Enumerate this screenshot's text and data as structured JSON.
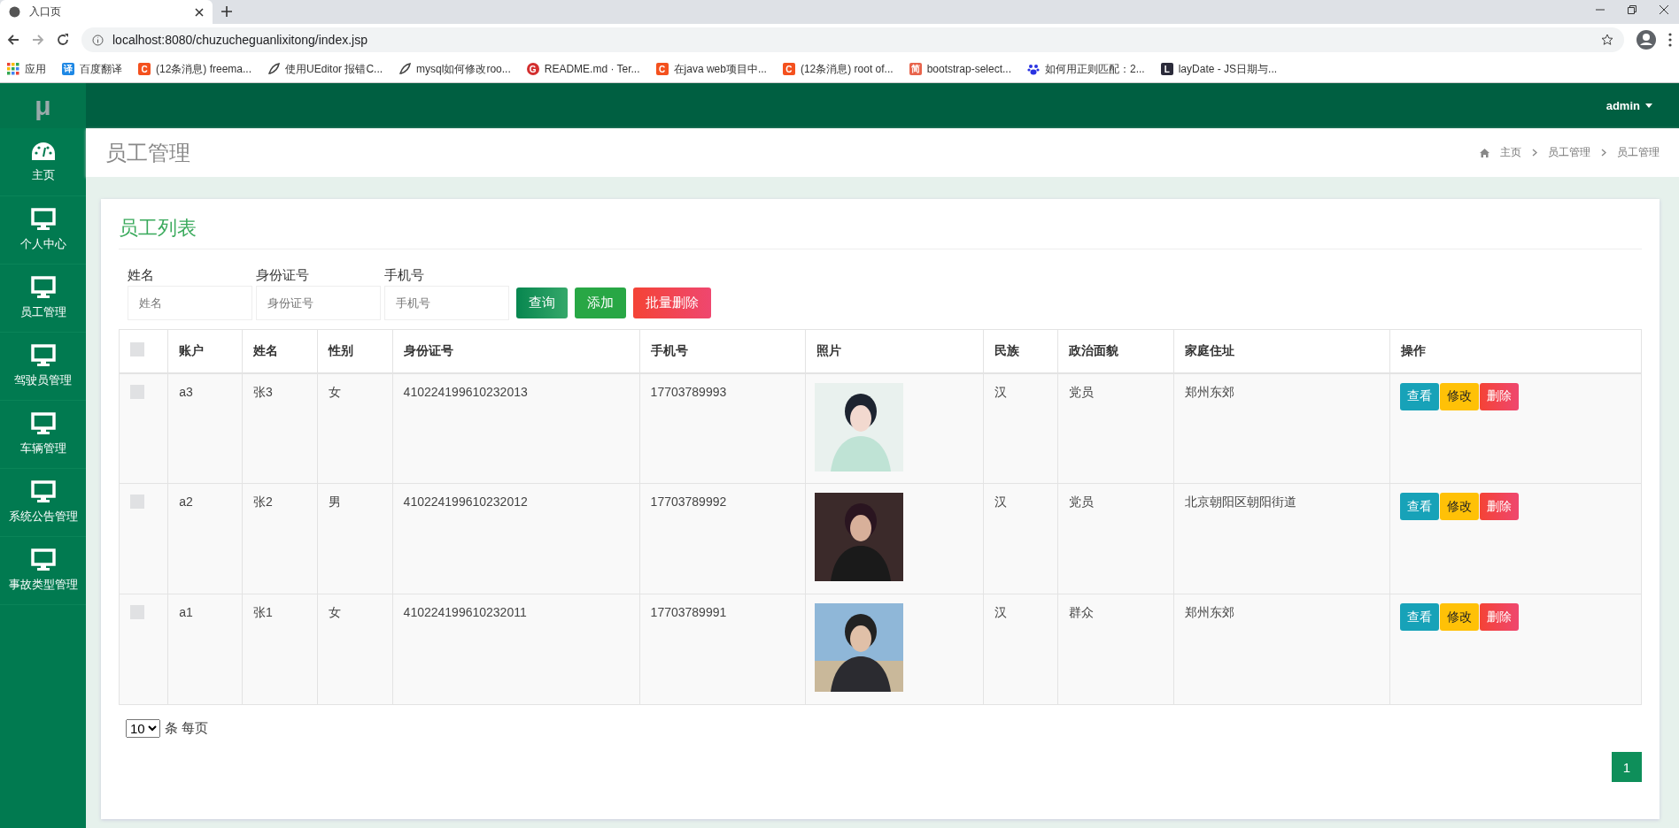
{
  "browser": {
    "tab_title": "入口页",
    "url": "localhost:8080/chuzucheguanlixitong/index.jsp",
    "bookmarks": [
      {
        "kind": "apps",
        "label": "应用"
      },
      {
        "kind": "badge",
        "badge": "译",
        "color": "#1e88e5",
        "label": "百度翻译"
      },
      {
        "kind": "badge",
        "badge": "C",
        "color": "#f4511e",
        "label": "(12条消息) freema..."
      },
      {
        "kind": "feather",
        "label": "使用UEditor 报错C..."
      },
      {
        "kind": "feather",
        "label": "mysql如何修改roo..."
      },
      {
        "kind": "circle",
        "badge": "G",
        "color": "#d32f2f",
        "label": "README.md · Ter..."
      },
      {
        "kind": "badge",
        "badge": "C",
        "color": "#f4511e",
        "label": "在java web项目中..."
      },
      {
        "kind": "badge",
        "badge": "C",
        "color": "#f4511e",
        "label": "(12条消息) root of..."
      },
      {
        "kind": "badge",
        "badge": "简",
        "color": "#e8634b",
        "label": "bootstrap-select..."
      },
      {
        "kind": "paw",
        "label": "如何用正则匹配：2..."
      },
      {
        "kind": "badge",
        "badge": "L",
        "color": "#2b2b3a",
        "label": "layDate - JS日期与..."
      }
    ]
  },
  "app": {
    "logo": "μ",
    "user": "admin"
  },
  "sidebar": {
    "items": [
      {
        "kind": "dashboard",
        "label": "主页"
      },
      {
        "kind": "monitor",
        "label": "个人中心"
      },
      {
        "kind": "monitor",
        "label": "员工管理"
      },
      {
        "kind": "monitor",
        "label": "驾驶员管理"
      },
      {
        "kind": "monitor",
        "label": "车辆管理"
      },
      {
        "kind": "monitor",
        "label": "系统公告管理"
      },
      {
        "kind": "monitor",
        "label": "事故类型管理"
      }
    ]
  },
  "page": {
    "title": "员工管理",
    "breadcrumb": [
      "主页",
      "员工管理",
      "员工管理"
    ]
  },
  "card": {
    "title": "员工列表",
    "filters": [
      {
        "label": "姓名",
        "placeholder": "姓名"
      },
      {
        "label": "身份证号",
        "placeholder": "身份证号"
      },
      {
        "label": "手机号",
        "placeholder": "手机号"
      }
    ],
    "actions": [
      {
        "kind": "search",
        "label": "查询"
      },
      {
        "kind": "add",
        "label": "添加"
      },
      {
        "kind": "delete",
        "label": "批量删除"
      }
    ],
    "table": {
      "header_checked": false,
      "columns": [
        "账户",
        "姓名",
        "性别",
        "身份证号",
        "手机号",
        "照片",
        "民族",
        "政治面貌",
        "家庭住址",
        "操作"
      ],
      "rows": [
        {
          "checked": false,
          "cells": [
            "a3",
            "张3",
            "女",
            "410224199610232013",
            "17703789993",
            {
              "kind": "picture"
            },
            "汉",
            "党员",
            "郑州东郊"
          ],
          "actions": [
            {
              "kind": "view",
              "label": "查看"
            },
            {
              "kind": "edit",
              "label": "修改"
            },
            {
              "kind": "delete",
              "label": "删除"
            }
          ]
        },
        {
          "checked": false,
          "cells": [
            "a2",
            "张2",
            "男",
            "410224199610232012",
            "17703789992",
            {
              "kind": "picture"
            },
            "汉",
            "党员",
            "北京朝阳区朝阳街道"
          ],
          "actions": [
            {
              "kind": "view",
              "label": "查看"
            },
            {
              "kind": "edit",
              "label": "修改"
            },
            {
              "kind": "delete",
              "label": "删除"
            }
          ]
        },
        {
          "checked": false,
          "cells": [
            "a1",
            "张1",
            "女",
            "410224199610232011",
            "17703789991",
            {
              "kind": "picture"
            },
            "汉",
            "群众",
            "郑州东郊"
          ],
          "actions": [
            {
              "kind": "view",
              "label": "查看"
            },
            {
              "kind": "edit",
              "label": "修改"
            },
            {
              "kind": "delete",
              "label": "删除"
            }
          ]
        }
      ]
    },
    "page_size": "10",
    "page_size_suffix": "条 每页",
    "pages": [
      {
        "label": "1",
        "selected": true
      }
    ]
  }
}
